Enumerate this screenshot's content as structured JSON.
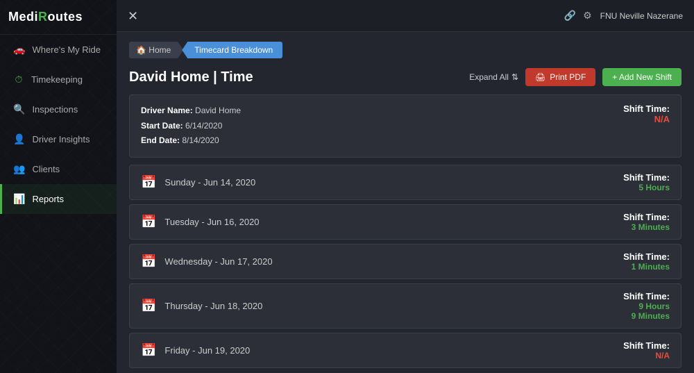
{
  "logo": {
    "prefix": "Medi",
    "highlight": "R",
    "suffix": "outes"
  },
  "nav": {
    "items": [
      {
        "id": "wheres-my-ride",
        "label": "Where's My Ride",
        "icon": "🚗",
        "active": false
      },
      {
        "id": "timekeeping",
        "label": "Timekeeping",
        "icon": "⏱",
        "active": false
      },
      {
        "id": "inspections",
        "label": "Inspections",
        "icon": "🔍",
        "active": false
      },
      {
        "id": "driver-insights",
        "label": "Driver Insights",
        "icon": "👤",
        "active": false
      },
      {
        "id": "clients",
        "label": "Clients",
        "icon": "👥",
        "active": false
      },
      {
        "id": "reports",
        "label": "Reports",
        "icon": "📊",
        "active": true
      }
    ]
  },
  "topbar": {
    "close_label": "✕",
    "user_name": "FNU Neville Nazerane"
  },
  "breadcrumb": {
    "home_label": "🏠 Home",
    "active_label": "Timecard Breakdown"
  },
  "page": {
    "title": "David Home | Time",
    "expand_all": "Expand All",
    "print_label": "🖨 Print PDF",
    "add_shift_label": "+ Add New Shift"
  },
  "driver_info": {
    "driver_name_label": "Driver Name:",
    "driver_name_value": "David Home",
    "start_date_label": "Start Date:",
    "start_date_value": "6/14/2020",
    "end_date_label": "End Date:",
    "end_date_value": "8/14/2020",
    "shift_time_label": "Shift Time:",
    "shift_time_value": "N/A",
    "shift_time_color": "red"
  },
  "shifts": [
    {
      "date": "Sunday - Jun 14, 2020",
      "shift_time_label": "Shift Time:",
      "shift_time_value": "5 Hours",
      "shift_time_color": "green"
    },
    {
      "date": "Tuesday - Jun 16, 2020",
      "shift_time_label": "Shift Time:",
      "shift_time_value": "3 Minutes",
      "shift_time_color": "green"
    },
    {
      "date": "Wednesday - Jun 17, 2020",
      "shift_time_label": "Shift Time:",
      "shift_time_value": "1 Minutes",
      "shift_time_color": "green"
    },
    {
      "date": "Thursday - Jun 18, 2020",
      "shift_time_label": "Shift Time:",
      "shift_time_value1": "9 Hours",
      "shift_time_value2": "9 Minutes",
      "shift_time_color": "green",
      "multi": true
    },
    {
      "date": "Friday - Jun 19, 2020",
      "shift_time_label": "Shift Time:",
      "shift_time_value": "N/A",
      "shift_time_color": "red"
    }
  ]
}
